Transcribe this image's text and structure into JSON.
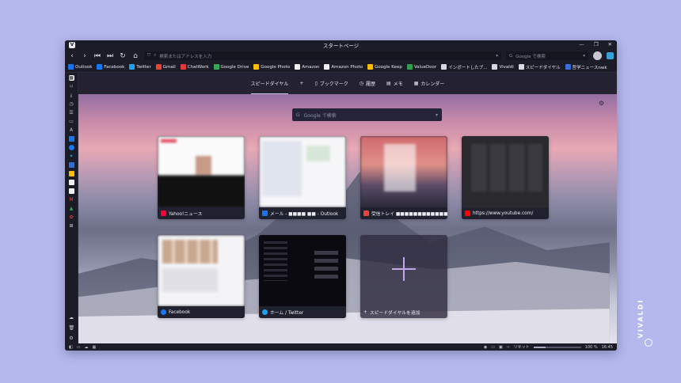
{
  "window": {
    "title": "スタートページ"
  },
  "nav": {
    "address_placeholder": "検索またはアドレスを入力",
    "search_placeholder": "Google で検索"
  },
  "bookmarks": [
    {
      "label": "Outlook",
      "color": "#1a73e8"
    },
    {
      "label": "Facebook",
      "color": "#1877f2"
    },
    {
      "label": "Twitter",
      "color": "#1da1f2"
    },
    {
      "label": "Gmail",
      "color": "#ea4335"
    },
    {
      "label": "ChatWork",
      "color": "#e03a3e"
    },
    {
      "label": "Google Drive",
      "color": "#34a853"
    },
    {
      "label": "Google Photo",
      "color": "#fbbc04"
    },
    {
      "label": "Amazon",
      "color": "#f0f0f0"
    },
    {
      "label": "Amazon Photo",
      "color": "#f0f0f0"
    },
    {
      "label": "Google Keep",
      "color": "#fbbc04"
    },
    {
      "label": "ValueDoor",
      "color": "#2e9e4f"
    },
    {
      "label": "インポートしたブ...",
      "color": "#d8d8e0"
    },
    {
      "label": "Vivaldi",
      "color": "#d8d8e0"
    },
    {
      "label": "スピードダイヤル",
      "color": "#d8d8e0"
    },
    {
      "label": "哲学ニュースnwk",
      "color": "#3a6ed8"
    }
  ],
  "tabs": [
    {
      "label": "スピードダイヤル"
    },
    {
      "label": "+"
    },
    {
      "label": "ブックマーク"
    },
    {
      "label": "履歴"
    },
    {
      "label": "メモ"
    },
    {
      "label": "カレンダー"
    }
  ],
  "google_search": {
    "placeholder": "Google で検索"
  },
  "dials": [
    {
      "label": "Yahoo!ニュース",
      "fav_color": "#ff0033"
    },
    {
      "label": "メール - ■■■■ ■■ - Outlook",
      "fav_color": "#1a73e8"
    },
    {
      "label": "受信トレイ ■■■■■■■■■■■■■■■",
      "fav_color": "#ea4335"
    },
    {
      "label": "https://www.youtube.com/",
      "fav_color": "#ff0000"
    },
    {
      "label": "Facebook",
      "fav_color": "#1877f2"
    },
    {
      "label": "ホーム / Twitter",
      "fav_color": "#1da1f2"
    },
    {
      "label": "スピードダイヤルを追加",
      "fav_color": "#e8e8f0"
    }
  ],
  "status": {
    "zoom": "100 %",
    "reset": "リセット",
    "time": "16:45",
    "zoom_level": 0.25
  },
  "brand": "VIVALDI",
  "colors": {
    "accent": "#c0a8e8",
    "background": "#b4b8ec",
    "chrome": "#1b1c27"
  }
}
